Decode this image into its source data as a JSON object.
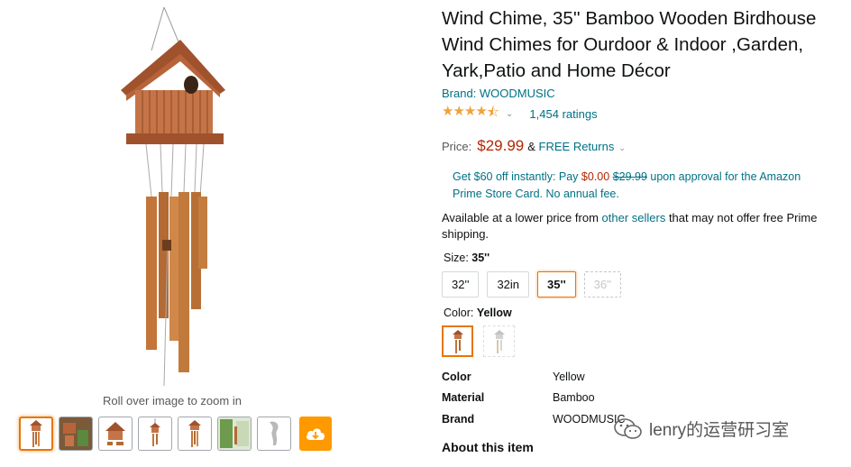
{
  "product": {
    "title": "Wind Chime, 35'' Bamboo Wooden Birdhouse Wind Chimes for Ourdoor & Indoor ,Garden, Yark,Patio and Home Décor",
    "brand_text": "Brand: WOODMUSIC",
    "rating_stars": 4.5,
    "rating_count": "1,454 ratings",
    "price_label": "Price:",
    "price": "$29.99",
    "price_connector": "&",
    "returns": "FREE Returns"
  },
  "promo": {
    "part1": "Get $60 off instantly: Pay ",
    "pay_price": "$0.00",
    "orig_price": "$29.99",
    "part2": " upon approval for the Amazon Prime Store Card. No annual fee."
  },
  "availability": {
    "before": "Available at a lower price from ",
    "link": "other sellers",
    "after": " that may not offer free Prime shipping."
  },
  "size": {
    "label": "Size:",
    "selected": "35''",
    "options": [
      "32''",
      "32in",
      "35''",
      "36''"
    ]
  },
  "color": {
    "label": "Color:",
    "selected": "Yellow"
  },
  "specs": [
    {
      "key": "Color",
      "value": "Yellow"
    },
    {
      "key": "Material",
      "value": "Bamboo"
    },
    {
      "key": "Brand",
      "value": "WOODMUSIC"
    }
  ],
  "about_heading": "About this item",
  "media": {
    "zoom_hint": "Roll over image to zoom in",
    "thumb_count": 7
  },
  "watermark": "lenry的运营研习室",
  "colors": {
    "link": "#007185",
    "price": "#b12704",
    "star": "#f0a23b",
    "selected_border": "#e77600",
    "cloud": "#ff9900"
  }
}
